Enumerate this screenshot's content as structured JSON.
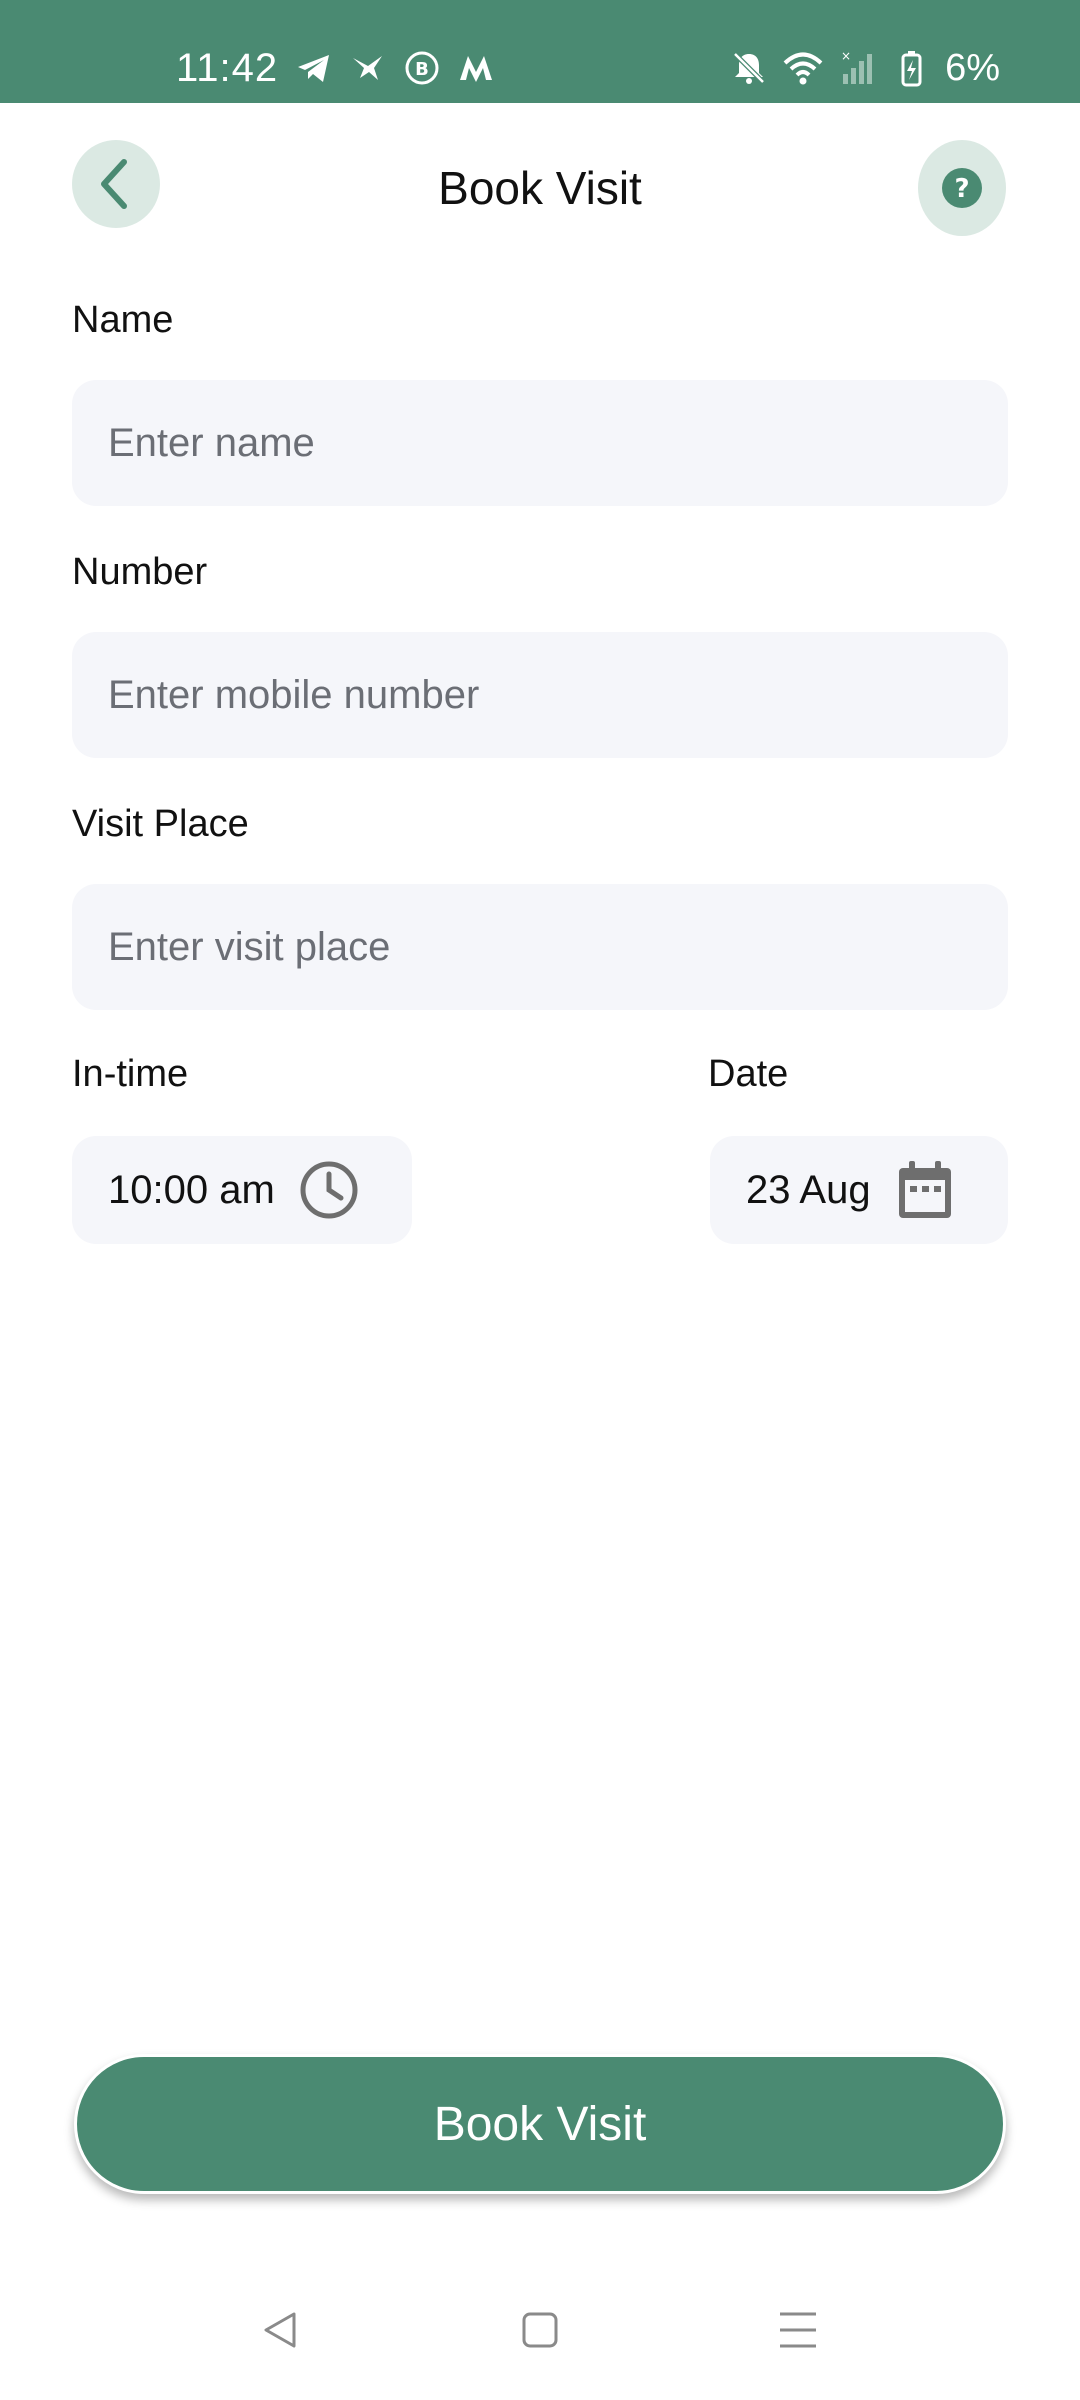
{
  "status_bar": {
    "time": "11:42",
    "battery": "6%",
    "left_icons": [
      "telegram-icon",
      "bird-icon",
      "b-circle-icon",
      "m-logo-icon"
    ],
    "right_icons": [
      "bell-off-icon",
      "wifi-icon",
      "signal-icon",
      "battery-charging-icon"
    ],
    "color": "#4a8a72"
  },
  "header": {
    "title": "Book Visit",
    "back_icon": "chevron-left-icon",
    "help_icon": "question-icon"
  },
  "form": {
    "name": {
      "label": "Name",
      "placeholder": "Enter name",
      "value": ""
    },
    "number": {
      "label": "Number",
      "placeholder": "Enter mobile number",
      "value": ""
    },
    "visit_place": {
      "label": "Visit Place",
      "placeholder": "Enter visit place",
      "value": ""
    },
    "in_time": {
      "label": "In-time",
      "value": "10:00 am",
      "icon": "clock-icon"
    },
    "date": {
      "label": "Date",
      "value": "23 Aug",
      "icon": "calendar-icon"
    }
  },
  "actions": {
    "book_label": "Book Visit"
  },
  "nav_bar": {
    "items": [
      "back-triangle-icon",
      "home-square-icon",
      "menu-lines-icon"
    ]
  },
  "colors": {
    "primary": "#4a8a72",
    "primary_light": "#dbe9e3",
    "input_bg": "#f5f6fa"
  }
}
